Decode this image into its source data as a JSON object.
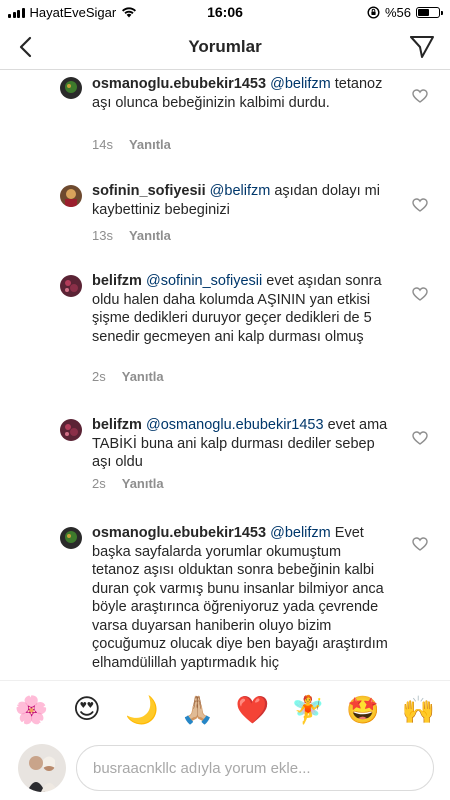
{
  "status_bar": {
    "carrier": "HayatEveSigar",
    "time": "16:06",
    "battery_text": "%56",
    "battery_level": 0.56
  },
  "header": {
    "title": "Yorumlar",
    "back_icon": "chevron-left-icon",
    "send_icon": "paper-plane-icon"
  },
  "comments": [
    {
      "username": "osmanoglu.ebubekir1453",
      "mention": "@belifzm",
      "text": " tetanoz aşı olunca bebeğinizin kalbimi durdu.",
      "time": "14s",
      "reply_label": "Yanıtla"
    },
    {
      "username": "sofinin_sofiyesii",
      "mention": "@belifzm",
      "text": " aşıdan dolayı mi kaybettiniz bebeginizi",
      "time": "13s",
      "reply_label": "Yanıtla"
    },
    {
      "username": "belifzm",
      "mention": "@sofinin_sofiyesii",
      "text": " evet aşıdan sonra oldu halen daha kolumda AŞININ yan etkisi şişme dedikleri duruyor geçer dedikleri de 5 senedir gecmeyen ani kalp durması olmuş",
      "time": "2s",
      "reply_label": "Yanıtla"
    },
    {
      "username": "belifzm",
      "mention": "@osmanoglu.ebubekir1453",
      "text": " evet ama TABİKİ buna ani kalp durması dediler sebep aşı oldu",
      "time": "2s",
      "reply_label": "Yanıtla"
    },
    {
      "username": "osmanoglu.ebubekir1453",
      "mention": "@belifzm",
      "text": " Evet başka sayfalarda yorumlar okumuştum tetanoz aşısı olduktan sonra bebeğinin kalbi duran çok varmış bunu insanlar bilmiyor anca böyle araştırınca öğreniyoruz yada çevrende varsa duyarsan haniberin oluyo bizim çocuğumuz olucak diye ben bayağı araştırdım elhamdülillah yaptırmadık hiç",
      "time": "",
      "reply_label": ""
    }
  ],
  "emojis": [
    {
      "char": "🌸",
      "icon": "cherry-blossom-icon"
    },
    {
      "char": "😍",
      "icon": "heart-eyes-icon"
    },
    {
      "char": "🌙",
      "icon": "crescent-moon-icon"
    },
    {
      "char": "🙏🏼",
      "icon": "folded-hands-icon"
    },
    {
      "char": "❤️",
      "icon": "red-heart-icon"
    },
    {
      "char": "🧚",
      "icon": "fairy-icon"
    },
    {
      "char": "🤩",
      "icon": "star-struck-icon"
    },
    {
      "char": "🙌",
      "icon": "raising-hands-icon"
    }
  ],
  "composer": {
    "placeholder": "busraacnkllc adıyla yorum ekle..."
  }
}
